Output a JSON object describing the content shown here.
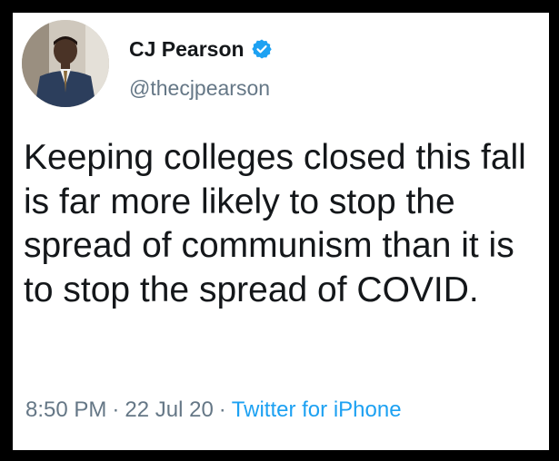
{
  "author": {
    "display_name": "CJ Pearson",
    "handle": "@thecjpearson",
    "verified": true,
    "avatar_icon": "profile-photo"
  },
  "tweet": {
    "text": "Keeping colleges closed this fall is far more likely to stop the spread of communism than it is to stop the spread of COVID.",
    "time": "8:50 PM",
    "separator": "·",
    "date": "22 Jul 20",
    "source": "Twitter for iPhone"
  },
  "colors": {
    "frame": "#000000",
    "text": "#14171a",
    "muted": "#657786",
    "link": "#1da1f2"
  }
}
